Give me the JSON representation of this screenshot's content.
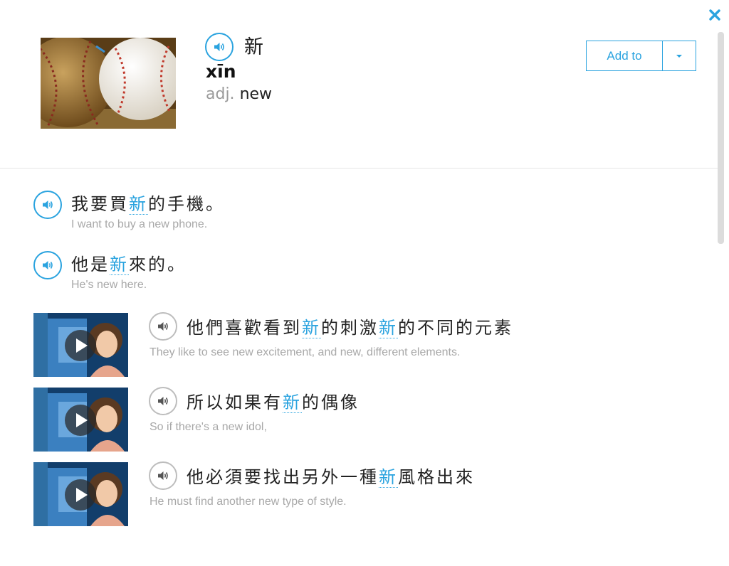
{
  "word": {
    "character": "新",
    "pinyin": "xīn",
    "part_of_speech": "adj.",
    "definition": "new",
    "add_to_label": "Add to"
  },
  "examples": [
    {
      "pre": "我要買",
      "word": "新",
      "post": "的手機。",
      "translation": "I want to buy a new phone."
    },
    {
      "pre": "他是",
      "word": "新",
      "post": "來的。",
      "translation": "He's new here."
    }
  ],
  "video_examples": [
    {
      "pre": "他們喜歡看到",
      "word": "新",
      "mid": "的刺激",
      "word2": "新",
      "post": "的不同的元素",
      "translation": "They like to see new excitement, and new, different elements."
    },
    {
      "pre": "所以如果有",
      "word": "新",
      "post": "的偶像",
      "translation": "So if there's a new idol,"
    },
    {
      "pre": "他必須要找出另外一種",
      "word": "新",
      "post": "風格出來",
      "translation": "He must find another new type of style."
    }
  ],
  "colors": {
    "accent": "#2aa3df",
    "muted": "#a8a8a8",
    "divider": "#e6e6e6"
  },
  "icons": [
    "close-icon",
    "speaker-icon",
    "chevron-down-icon",
    "play-icon"
  ]
}
